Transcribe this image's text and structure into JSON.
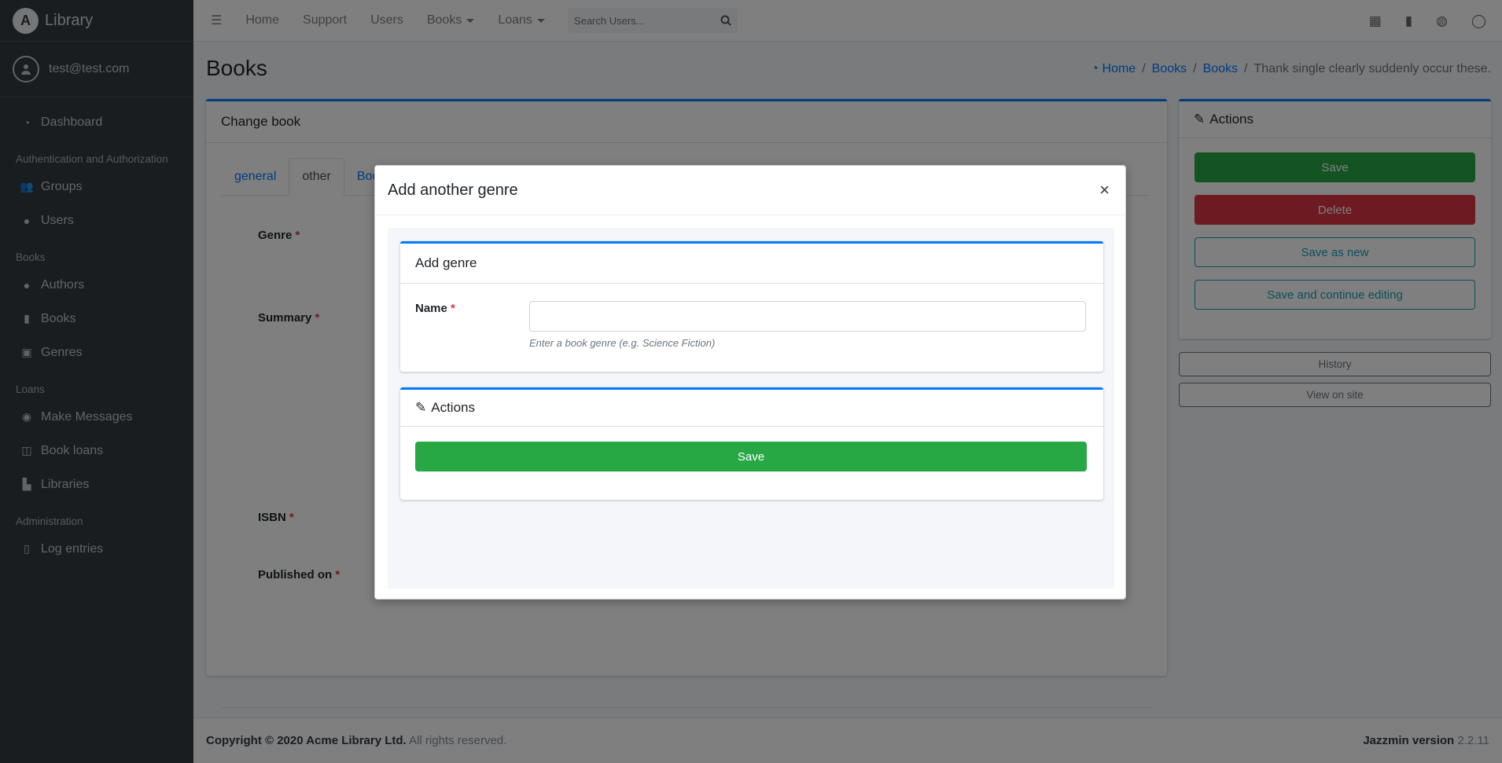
{
  "app": {
    "brand": "Library",
    "user": "test@test.com"
  },
  "sidebar": {
    "dashboard": "Dashboard",
    "sections": [
      {
        "header": "Authentication and Authorization",
        "items": [
          {
            "label": "Groups",
            "icon": "users-icon"
          },
          {
            "label": "Users",
            "icon": "user-icon"
          }
        ]
      },
      {
        "header": "Books",
        "items": [
          {
            "label": "Authors",
            "icon": "user-icon"
          },
          {
            "label": "Books",
            "icon": "book-icon"
          },
          {
            "label": "Genres",
            "icon": "photo-icon"
          }
        ]
      },
      {
        "header": "Loans",
        "items": [
          {
            "label": "Make Messages",
            "icon": "comments-icon"
          },
          {
            "label": "Book loans",
            "icon": "book-open-icon"
          },
          {
            "label": "Libraries",
            "icon": "building-icon"
          }
        ]
      },
      {
        "header": "Administration",
        "items": [
          {
            "label": "Log entries",
            "icon": "file-icon"
          }
        ]
      }
    ]
  },
  "topbar": {
    "links": [
      "Home",
      "Support",
      "Users"
    ],
    "dropdowns": [
      "Books",
      "Loans"
    ],
    "search_placeholder": "Search Users..."
  },
  "page": {
    "title": "Books",
    "breadcrumb": [
      "Home",
      "Books",
      "Books"
    ],
    "breadcrumb_current": "Thank single clearly suddenly occur these.",
    "card_title": "Change book",
    "tabs": [
      "general",
      "other",
      "Boo"
    ],
    "fields": [
      "Genre",
      "Summary",
      "ISBN",
      "Published on"
    ],
    "required_mark": "*"
  },
  "actions": {
    "title": "Actions",
    "save": "Save",
    "delete": "Delete",
    "save_as_new": "Save as new",
    "save_continue": "Save and continue editing",
    "history": "History",
    "view_on_site": "View on site"
  },
  "footer": {
    "copyright_bold": "Copyright © 2020 Acme Library Ltd.",
    "copyright_rest": "All rights reserved.",
    "version_label": "Jazzmin version",
    "version": "2.2.11"
  },
  "modal": {
    "title": "Add another genre",
    "close": "×",
    "card_title": "Add genre",
    "name_label": "Name",
    "name_value": "",
    "help": "Enter a book genre (e.g. Science Fiction)",
    "actions_title": "Actions",
    "save": "Save"
  },
  "colors": {
    "primary": "#007bff",
    "success": "#28a745",
    "danger": "#dc3545",
    "info": "#17a2b8",
    "sidebar": "#343a40"
  }
}
